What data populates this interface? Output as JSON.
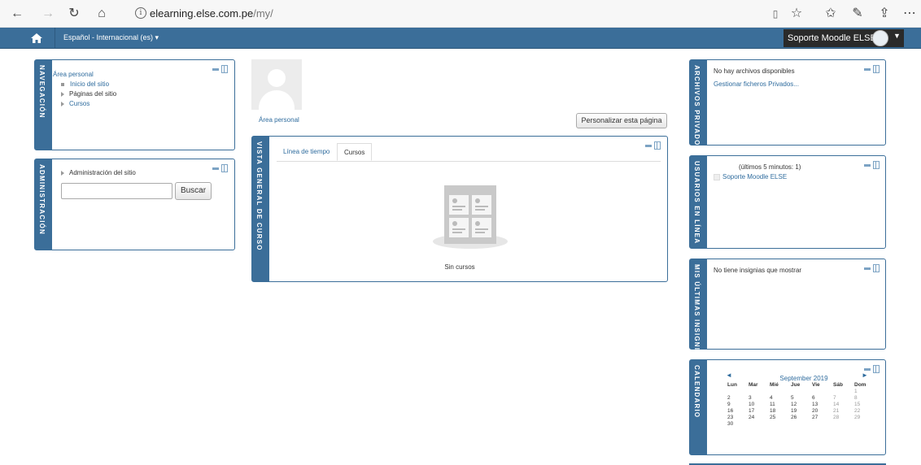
{
  "browser": {
    "url_host": "elearning.else.com.pe",
    "url_path": "/my/"
  },
  "navbar": {
    "language": "Español - Internacional (es) ▾",
    "user_name": "Soporte Moodle ELSE"
  },
  "blocks": {
    "navegacion": {
      "title": "NAVEGACIÓN",
      "items": [
        "Área personal",
        "Inicio del sitio",
        "Páginas del sitio",
        "Cursos"
      ]
    },
    "administracion": {
      "title": "ADMINISTRACIÓN",
      "item": "Administración del sitio",
      "search_button": "Buscar",
      "search_value": ""
    },
    "vista_general": {
      "title": "VISTA GENERAL DE CURSO",
      "tabs": [
        "Línea de tiempo",
        "Cursos"
      ],
      "active_tab": "Cursos",
      "empty_text": "Sin cursos"
    },
    "archivos": {
      "title": "ARCHIVOS PRIVADO",
      "empty": "No hay archivos disponibles",
      "manage_link": "Gestionar ficheros Privados..."
    },
    "usuarios": {
      "title": "USUARIOS EN LÍNEA",
      "header": "(últimos 5 minutos: 1)",
      "users": [
        "Soporte Moodle ELSE"
      ]
    },
    "insignias": {
      "title": "MIS ÚLTIMAS INSIGNI",
      "empty": "No tiene insignias que mostrar"
    },
    "calendario": {
      "title": "CALENDARIO",
      "month": "September 2019",
      "prev": "◄",
      "next": "►",
      "weekdays": [
        "Lun",
        "Mar",
        "Mié",
        "Jue",
        "Vie",
        "Sáb",
        "Dom"
      ],
      "weeks": [
        [
          "",
          "",
          "",
          "",
          "",
          "",
          "1"
        ],
        [
          "2",
          "3",
          "4",
          "5",
          "6",
          "7",
          "8"
        ],
        [
          "9",
          "10",
          "11",
          "12",
          "13",
          "14",
          "15"
        ],
        [
          "16",
          "17",
          "18",
          "19",
          "20",
          "21",
          "22"
        ],
        [
          "23",
          "24",
          "25",
          "26",
          "27",
          "28",
          "29"
        ],
        [
          "30",
          "",
          "",
          "",
          "",
          "",
          ""
        ]
      ]
    }
  },
  "main": {
    "area_personal_link": "Área personal",
    "customize_button": "Personalizar esta página"
  },
  "colors": {
    "brand": "#3b6e99",
    "link": "#2f6c9e"
  }
}
